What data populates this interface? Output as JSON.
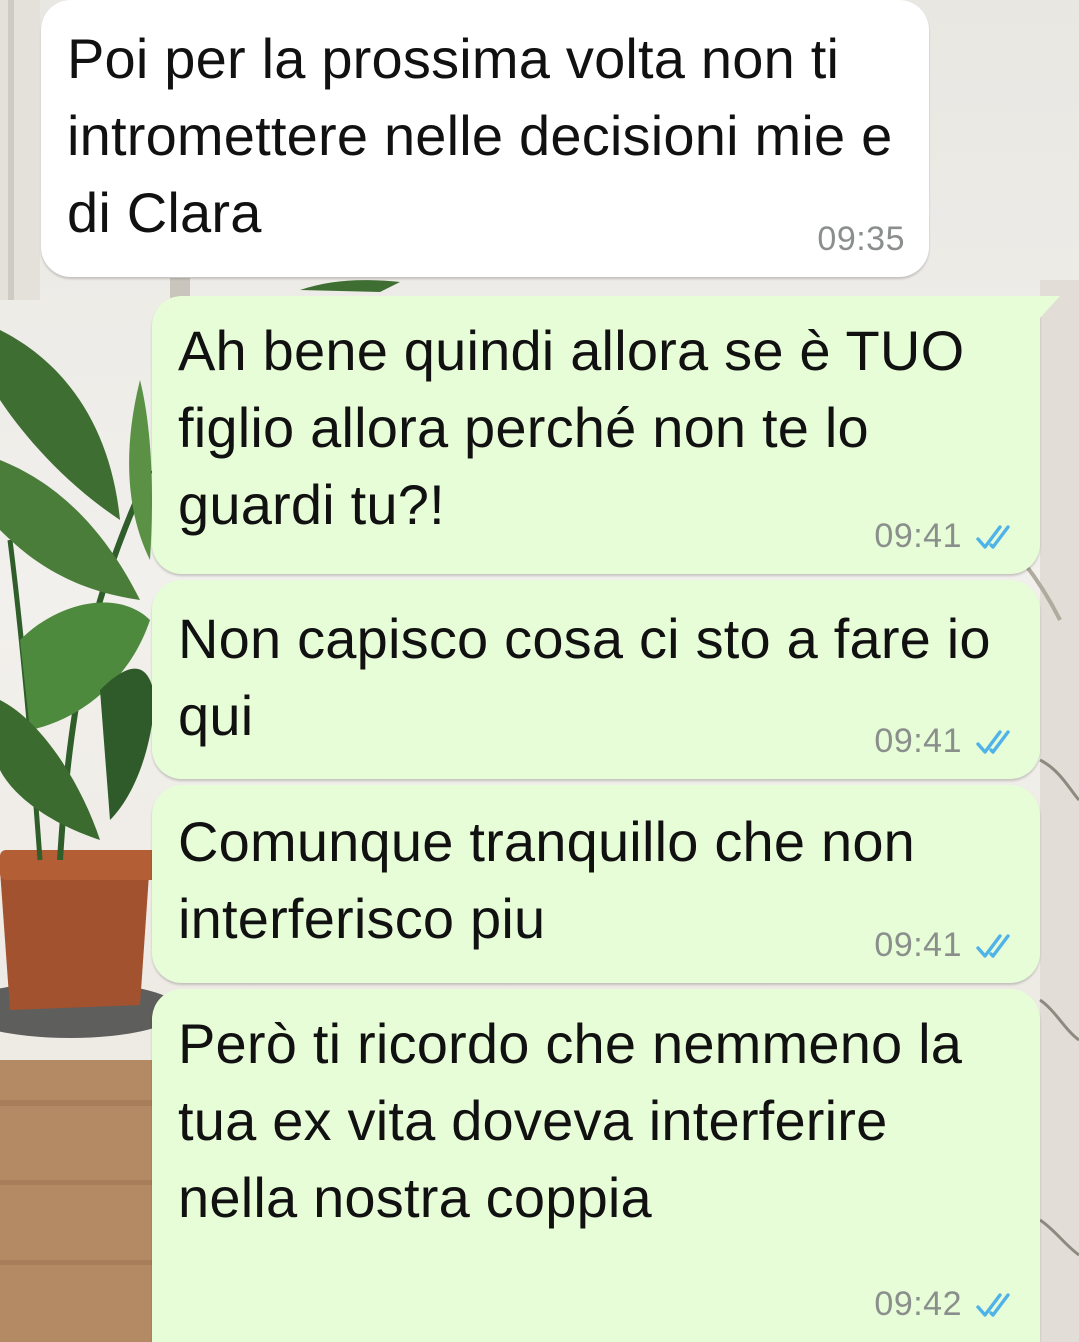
{
  "colors": {
    "incoming_bubble": "#ffffff",
    "outgoing_bubble": "#e7fdd8",
    "timestamp": "#8a8f8c",
    "read_ticks": "#4fb3e8",
    "text": "#111111"
  },
  "messages": [
    {
      "direction": "incoming",
      "text": "Poi per la prossima volta non ti intromettere nelle decisioni mie e di Clara",
      "time": "09:35"
    },
    {
      "direction": "outgoing",
      "text": "Ah bene quindi allora se è TUO figlio allora perché non te lo guardi tu?!",
      "time": "09:41",
      "status_icon": "double-check-read-icon"
    },
    {
      "direction": "outgoing",
      "text": "Non capisco cosa ci sto a fare io qui",
      "time": "09:41",
      "status_icon": "double-check-read-icon"
    },
    {
      "direction": "outgoing",
      "text": "Comunque tranquillo che non interferisco piu",
      "time": "09:41",
      "status_icon": "double-check-read-icon"
    },
    {
      "direction": "outgoing",
      "text": "Però ti ricordo che nemmeno la tua ex vita doveva interferire nella nostra coppia",
      "time": "09:42",
      "status_icon": "double-check-read-icon"
    }
  ]
}
